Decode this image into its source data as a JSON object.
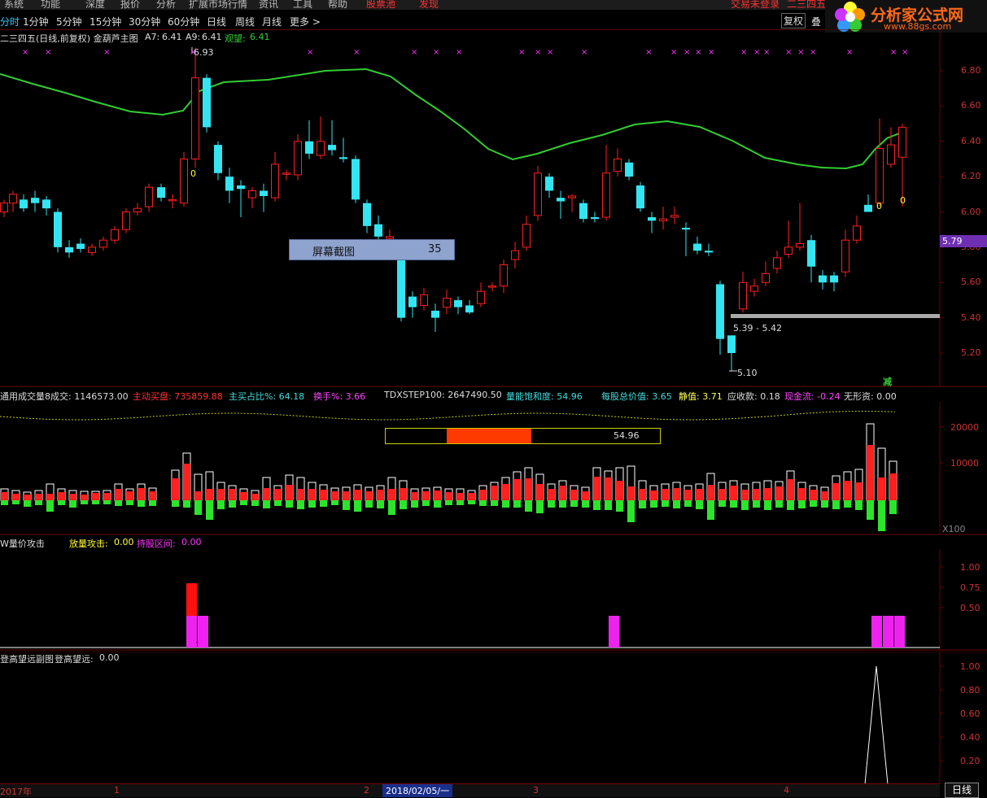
{
  "menubar": {
    "items": [
      "系统",
      "功能",
      "深度",
      "报价",
      "分析",
      "扩展市场行情",
      "资讯",
      "工具",
      "帮助"
    ],
    "stock_pool": "股票池",
    "discover": "发现",
    "login_status": "交易未登录",
    "right_title": "二三四五"
  },
  "periods": {
    "items": [
      "分时",
      "1分钟",
      "5分钟",
      "15分钟",
      "30分钟",
      "60分钟",
      "日线",
      "周线",
      "月线",
      "更多 >"
    ],
    "fuquan": "复权",
    "overlay": "叠"
  },
  "logo": {
    "title": "分析家公式网",
    "url": "www.88gs.com"
  },
  "main_panel": {
    "title": "二三四五(日线,前复权) 金葫芦主图",
    "a7_label": "A7:",
    "a7_value": "6.41",
    "a9_label": "A9:",
    "a9_value": "6.41",
    "watch_label": "观望:",
    "watch_value": "6.41",
    "high_label": "6.93",
    "low_label": "5.10",
    "range_label": "5.39 - 5.42",
    "current_price": "5.79",
    "zero_markers": [
      "0",
      "0",
      "0"
    ],
    "reduce_label": "减",
    "y_ticks": [
      "6.80",
      "6.60",
      "6.40",
      "6.20",
      "6.00",
      "5.80",
      "5.60",
      "5.40",
      "5.20"
    ]
  },
  "screenshot_overlay": {
    "label": "屏幕截图",
    "count": "35"
  },
  "volume_panel": {
    "title": "通用成交量8",
    "fields": [
      {
        "label": "成交:",
        "value": "1146573.00",
        "color": "#dddddd"
      },
      {
        "label": "主动买盘:",
        "value": "735859.88",
        "color": "#ff3333"
      },
      {
        "label": "主买占比%:",
        "value": "64.18",
        "color": "#44dddd"
      },
      {
        "label": "换手%:",
        "value": "3.66",
        "color": "#ff44ff"
      },
      {
        "label": "TDXSTEP100:",
        "value": "2647490.50",
        "color": "#dddddd"
      },
      {
        "label": "量能饱和度:",
        "value": "54.96",
        "color": "#44dddd"
      },
      {
        "label": "每股总价值:",
        "value": "3.65",
        "color": "#44dddd"
      },
      {
        "label": "静值:",
        "value": "3.71",
        "color": "#ffff55"
      },
      {
        "label": "应收款:",
        "value": "0.18",
        "color": "#dddddd"
      },
      {
        "label": "现金流:",
        "value": "-0.24",
        "color": "#ff44ff"
      },
      {
        "label": "无形资:",
        "value": "0.00",
        "color": "#dddddd"
      }
    ],
    "saturation_value": "54.96",
    "saturation_percent": 54.96,
    "y_ticks": [
      "20000",
      "10000"
    ],
    "multiplier": "X100"
  },
  "attack_panel": {
    "title": "W量价攻击",
    "field1_label": "放量攻击:",
    "field1_value": "0.00",
    "field2_label": "持股区间:",
    "field2_value": "0.00",
    "y_ticks": [
      "1.00",
      "0.75",
      "0.50"
    ]
  },
  "climb_panel": {
    "title": "登高望远副图",
    "field_label": "登高望远:",
    "field_value": "0.00",
    "y_ticks": [
      "1.00",
      "0.80",
      "0.60",
      "0.40",
      "0.20"
    ]
  },
  "timeline": {
    "labels": [
      "2017年",
      "1",
      "2",
      "3",
      "4"
    ],
    "cursor_date": "2018/02/05/一",
    "tab_label": "日线"
  },
  "colors": {
    "up": "#ff2020",
    "down": "#33e5f2",
    "ma": "#33cc33",
    "magenta": "#ff33ff",
    "grid": "#660000",
    "axis_text": "#cc3333"
  }
}
